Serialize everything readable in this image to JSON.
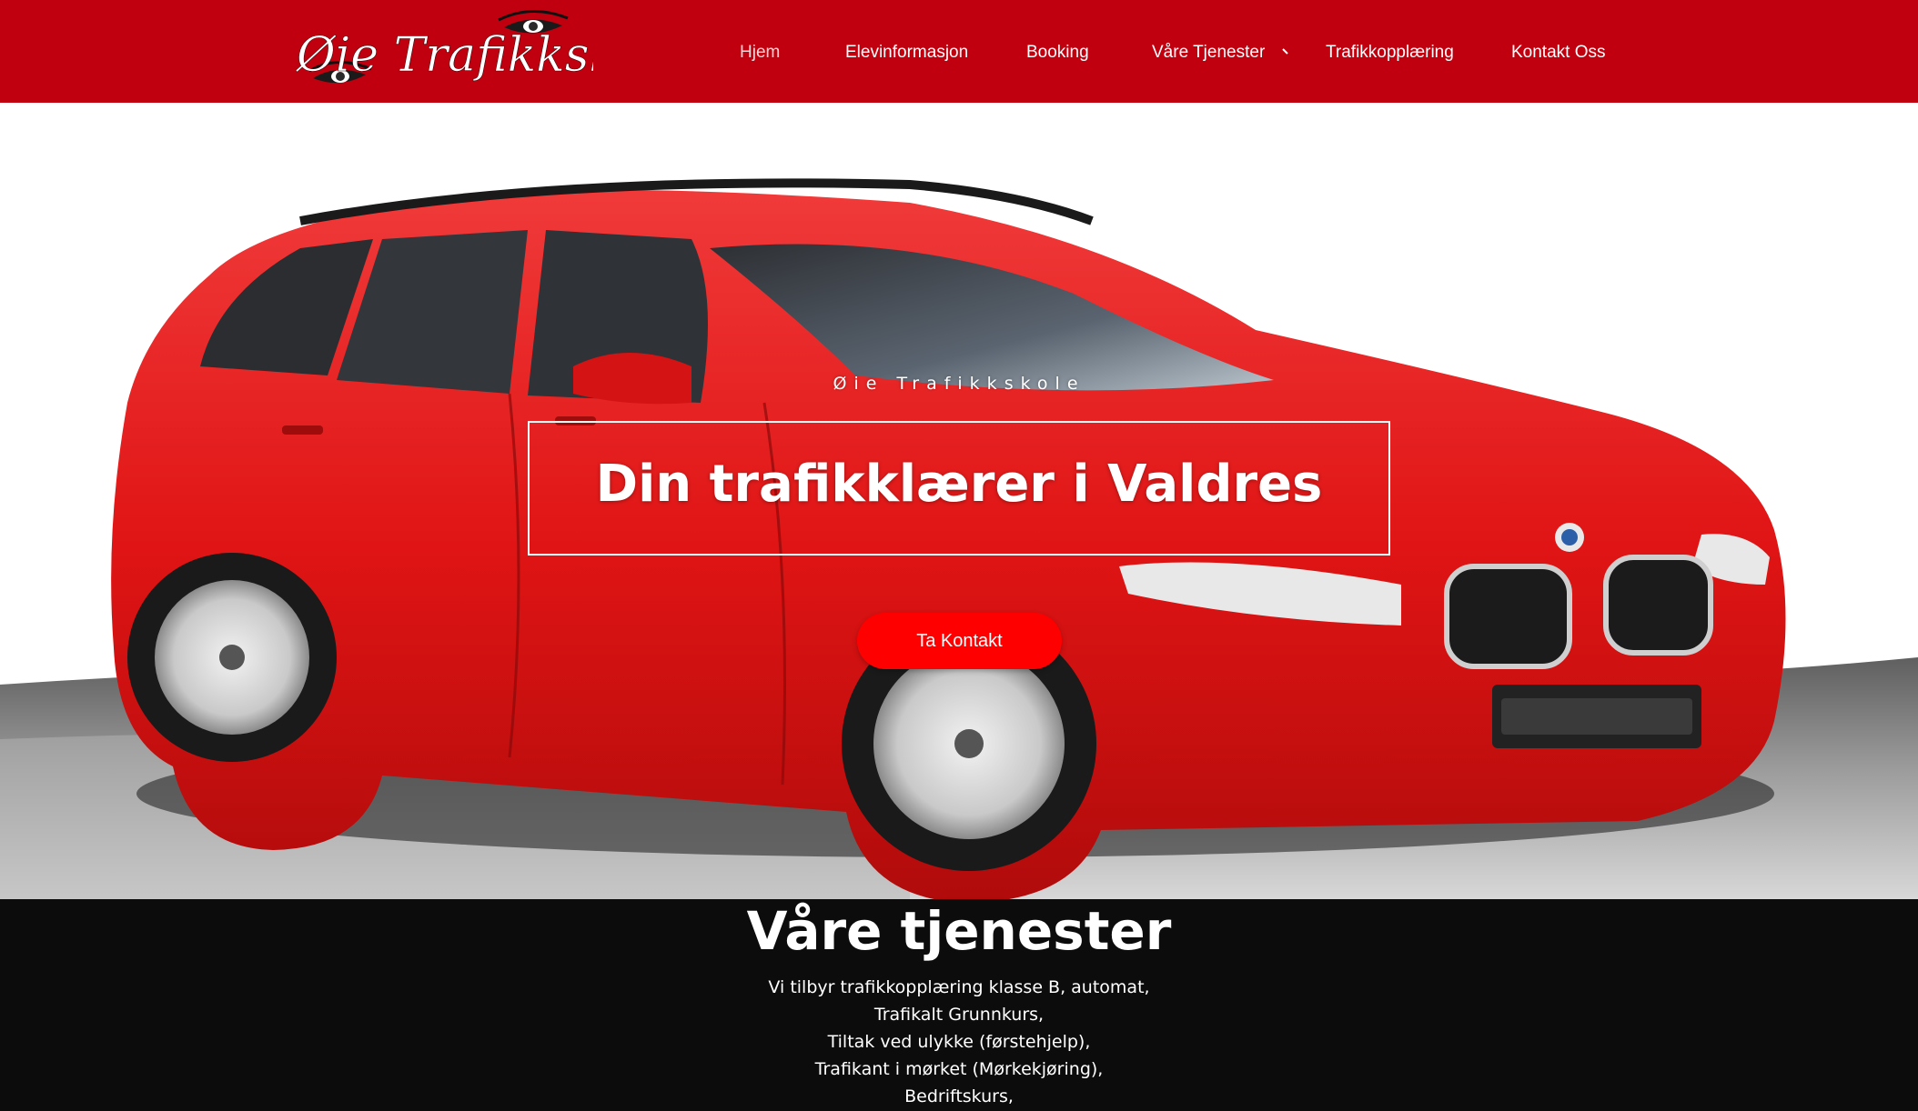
{
  "header": {
    "logo_text": "Øie Trafikkskole",
    "brand_color": "#c1000f",
    "nav": [
      {
        "label": "Hjem",
        "active": true
      },
      {
        "label": "Elevinformasjon"
      },
      {
        "label": "Booking"
      },
      {
        "label": "Våre Tjenester",
        "has_dropdown": true
      },
      {
        "label": "Trafikkopplæring"
      },
      {
        "label": "Kontakt Oss"
      }
    ]
  },
  "hero": {
    "kicker": "Øie Trafikkskole",
    "title": "Din trafikklærer i Valdres",
    "cta_label": "Ta Kontakt",
    "cta_color": "#ff0000",
    "image": "red-station-wagon-car"
  },
  "services": {
    "title": "Våre tjenester",
    "items": [
      "Vi tilbyr trafikkopplæring klasse B, automat,",
      "Trafikalt Grunnkurs,",
      "Tiltak ved ulykke (førstehjelp),",
      "Trafikant i mørket (Mørkekjøring),",
      "Bedriftskurs,"
    ]
  }
}
